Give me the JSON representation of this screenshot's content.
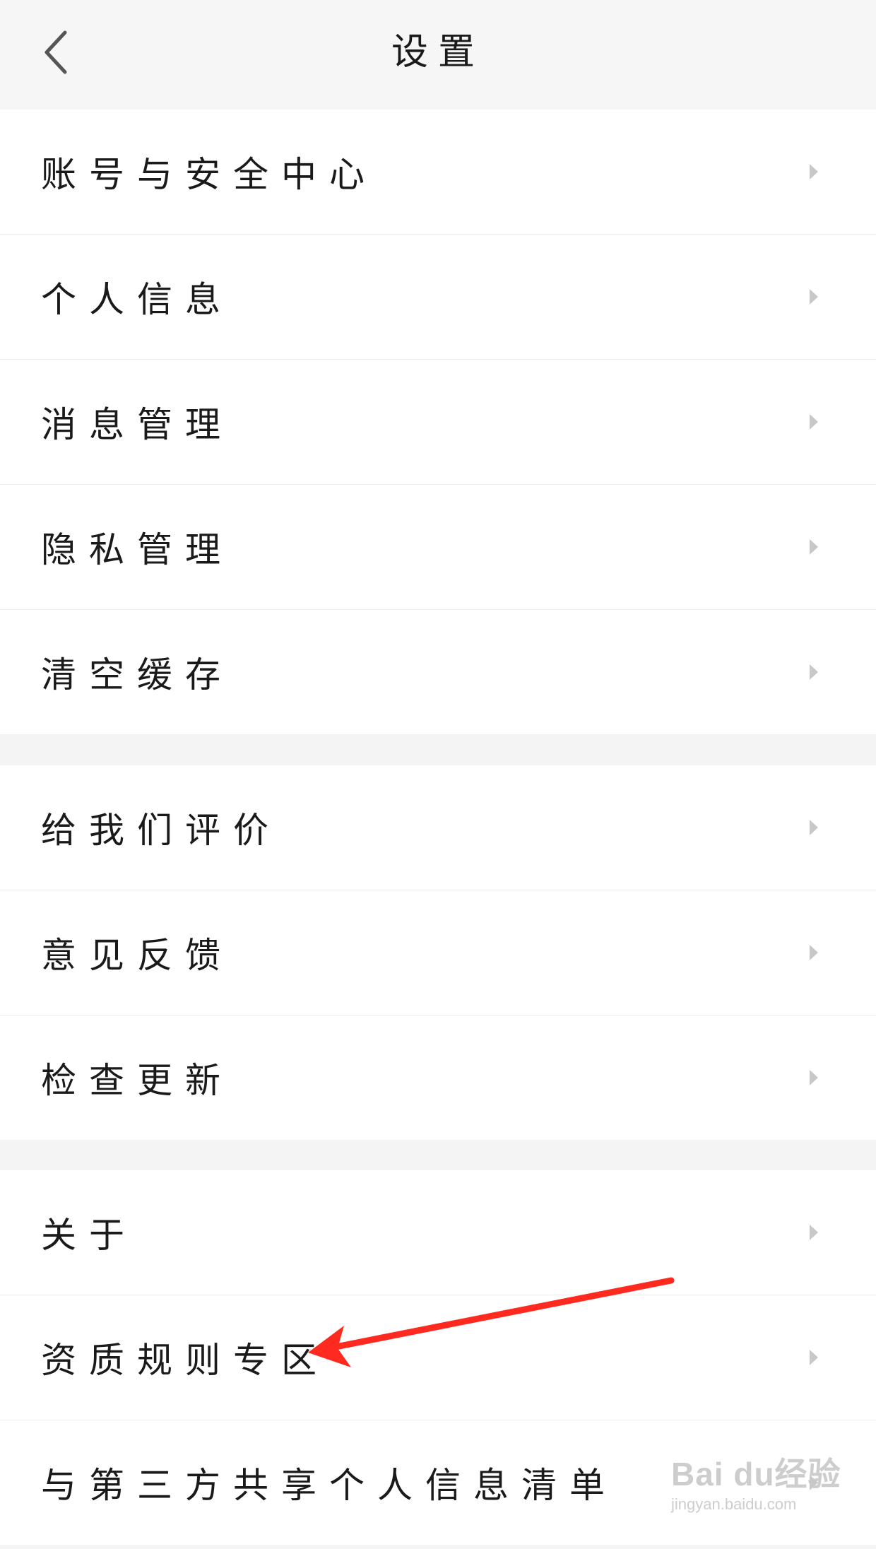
{
  "header": {
    "title": "设置",
    "back_icon": "chevron-left-icon"
  },
  "groups": [
    {
      "items": [
        {
          "label": "账号与安全中心"
        },
        {
          "label": "个人信息"
        },
        {
          "label": "消息管理"
        },
        {
          "label": "隐私管理"
        },
        {
          "label": "清空缓存"
        }
      ]
    },
    {
      "items": [
        {
          "label": "给我们评价"
        },
        {
          "label": "意见反馈"
        },
        {
          "label": "检查更新"
        }
      ]
    },
    {
      "items": [
        {
          "label": "关于"
        },
        {
          "label": "资质规则专区"
        },
        {
          "label": "与第三方共享个人信息清单"
        }
      ]
    }
  ],
  "annotation": {
    "color": "#ff2a1f",
    "points_to": "资质规则专区"
  },
  "watermark": {
    "logo": "Bai du经验",
    "url": "jingyan.baidu.com"
  }
}
